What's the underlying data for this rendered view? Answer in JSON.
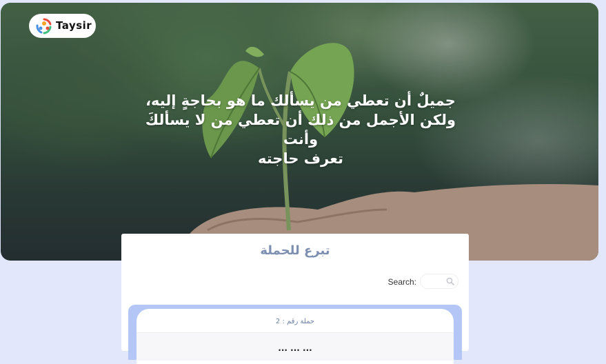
{
  "brand": {
    "name": "Taysir",
    "logo_icon": "people-circle-logo-icon",
    "colors": [
      "#e94e3c",
      "#f5a623",
      "#4a90e2",
      "#3fbf7f"
    ]
  },
  "hero": {
    "quote_lines": [
      "جميلٌ أن تعطي من يسألك ما هو بحاجةٍ إليه،",
      "ولكن الأجمل من ذلك أن تعطي من لا يسألكَ وأنت",
      "تعرف حاجته"
    ],
    "image": "hands-holding-seedling"
  },
  "donate_card": {
    "title": "تبرع للحملة",
    "search": {
      "label": "Search:",
      "value": "",
      "placeholder": "",
      "icon": "search-icon"
    },
    "campaigns": [
      {
        "header": "حملة رقم : 2",
        "subtitle": "... ... ..."
      }
    ]
  },
  "colors": {
    "page_background": "#e3e7fb",
    "card_title": "#7d8fb1",
    "list_frame": "#b4c6f6"
  }
}
